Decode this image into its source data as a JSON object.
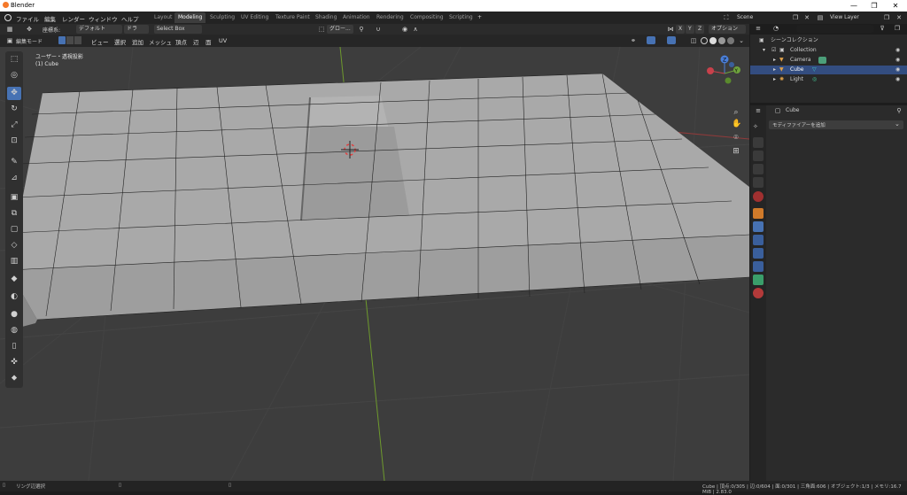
{
  "window": {
    "title": "Blender",
    "min": "—",
    "max": "❐",
    "close": "✕"
  },
  "menu": [
    "ファイル",
    "編集",
    "レンダー",
    "ウィンドウ",
    "ヘルプ"
  ],
  "workspaces": [
    "Layout",
    "Modeling",
    "Sculpting",
    "UV Editing",
    "Texture Paint",
    "Shading",
    "Animation",
    "Rendering",
    "Compositing",
    "Scripting"
  ],
  "workspace_add": "+",
  "scene": {
    "name": "Scene",
    "view_layer": "View Layer"
  },
  "header1": {
    "transform_label": "座標系:",
    "orientation": "デフォルト",
    "drag": "ドラッ...",
    "select_mode": "Select Box",
    "pivot": "グロー...",
    "options": "オプション",
    "axes": [
      "X",
      "Y",
      "Z"
    ]
  },
  "header2": {
    "mode": "編集モード",
    "menus": [
      "ビュー",
      "選択",
      "追加",
      "メッシュ",
      "頂点",
      "辺",
      "面",
      "UV"
    ]
  },
  "viewport": {
    "view_name": "ユーザー・透視投影",
    "object_name": "(1) Cube"
  },
  "gizmo": {
    "x": "X",
    "y": "Y",
    "z": "Z"
  },
  "outliner": {
    "title": "シーンコレクション",
    "search_placeholder": "",
    "items": [
      {
        "label": "Collection",
        "selected": false
      },
      {
        "label": "Camera",
        "selected": false
      },
      {
        "label": "Cube",
        "selected": true
      },
      {
        "label": "Light",
        "selected": false
      }
    ]
  },
  "properties": {
    "object": "Cube",
    "add_modifier": "モディファイアーを追加"
  },
  "status": {
    "left": "リング辺選択",
    "right": "Cube | 頂点:0/305 | 辺:0/604 | 面:0/301 | 三角面:606 | オブジェクト:1/3 | メモリ:16.7 MiB | 2.83.0"
  },
  "colors": {
    "accent": "#4772b3",
    "selection": "#334d80",
    "mesh": "#a9a9a9",
    "grid": "#474747"
  }
}
